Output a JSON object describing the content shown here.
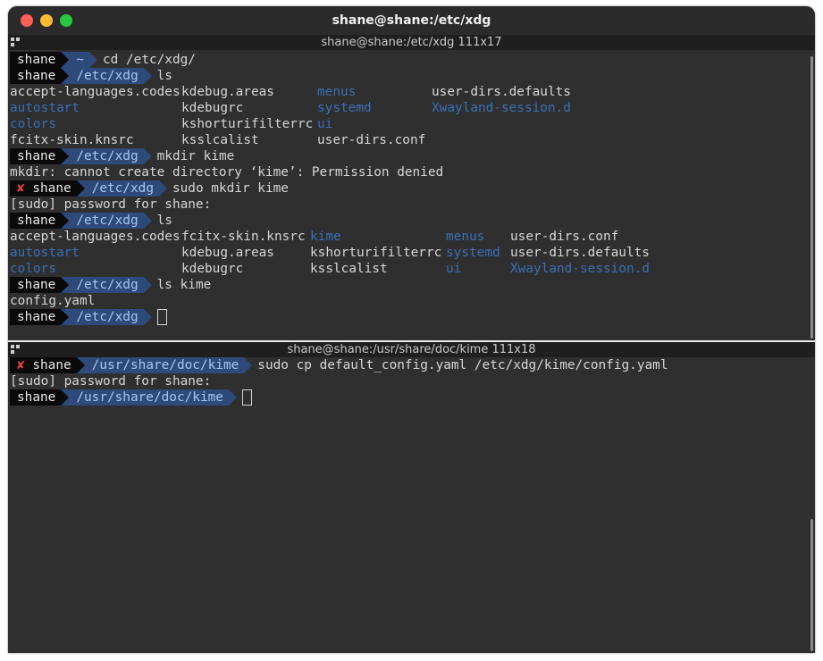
{
  "window": {
    "title": "shane@shane:/etc/xdg"
  },
  "pane1": {
    "header": "shane@shane:/etc/xdg 111x17",
    "prompt_user": "shane",
    "err_mark": "✘",
    "lines": [
      {
        "type": "prompt",
        "path": "~",
        "cmd": "cd /etc/xdg/"
      },
      {
        "type": "prompt",
        "path": "/etc/xdg",
        "cmd": "ls"
      },
      {
        "type": "ls4",
        "cols": [
          "accept-languages.codes",
          "kdebug.areas",
          "menus",
          "user-dirs.defaults"
        ],
        "dirs": [
          false,
          false,
          true,
          false
        ]
      },
      {
        "type": "ls4",
        "cols": [
          "autostart",
          "kdebugrc",
          "systemd",
          "Xwayland-session.d"
        ],
        "dirs": [
          true,
          false,
          true,
          true
        ]
      },
      {
        "type": "ls4",
        "cols": [
          "colors",
          "kshorturifilterrc",
          "ui",
          ""
        ],
        "dirs": [
          true,
          false,
          true,
          false
        ]
      },
      {
        "type": "ls4",
        "cols": [
          "fcitx-skin.knsrc",
          "ksslcalist",
          "user-dirs.conf",
          ""
        ],
        "dirs": [
          false,
          false,
          false,
          false
        ]
      },
      {
        "type": "prompt",
        "path": "/etc/xdg",
        "cmd": "mkdir kime"
      },
      {
        "type": "text",
        "text": "mkdir: cannot create directory ‘kime’: Permission denied"
      },
      {
        "type": "prompt",
        "err": true,
        "path": "/etc/xdg",
        "cmd": "sudo mkdir kime"
      },
      {
        "type": "text",
        "text": "[sudo] password for shane:"
      },
      {
        "type": "prompt",
        "path": "/etc/xdg",
        "cmd": "ls"
      },
      {
        "type": "ls5",
        "cols": [
          "accept-languages.codes",
          "fcitx-skin.knsrc",
          "kime",
          "menus",
          "user-dirs.conf"
        ],
        "dirs": [
          false,
          false,
          true,
          true,
          false
        ]
      },
      {
        "type": "ls5",
        "cols": [
          "autostart",
          "kdebug.areas",
          "kshorturifilterrc",
          "systemd",
          "user-dirs.defaults"
        ],
        "dirs": [
          true,
          false,
          false,
          true,
          false
        ]
      },
      {
        "type": "ls5",
        "cols": [
          "colors",
          "kdebugrc",
          "ksslcalist",
          "ui",
          "Xwayland-session.d"
        ],
        "dirs": [
          true,
          false,
          false,
          true,
          true
        ]
      },
      {
        "type": "prompt",
        "path": "/etc/xdg",
        "cmd": "ls kime"
      },
      {
        "type": "text",
        "text": "config.yaml"
      },
      {
        "type": "prompt",
        "path": "/etc/xdg",
        "cmd": "",
        "cursor": true
      }
    ]
  },
  "pane2": {
    "header": "shane@shane:/usr/share/doc/kime 111x18",
    "prompt_user": "shane",
    "err_mark": "✘",
    "lines": [
      {
        "type": "prompt",
        "err": true,
        "path": "/usr/share/doc/kime",
        "cmd": "sudo cp default_config.yaml /etc/xdg/kime/config.yaml"
      },
      {
        "type": "text",
        "text": "[sudo] password for shane:"
      },
      {
        "type": "prompt",
        "path": "/usr/share/doc/kime",
        "cmd": "",
        "cursor": true
      }
    ]
  }
}
